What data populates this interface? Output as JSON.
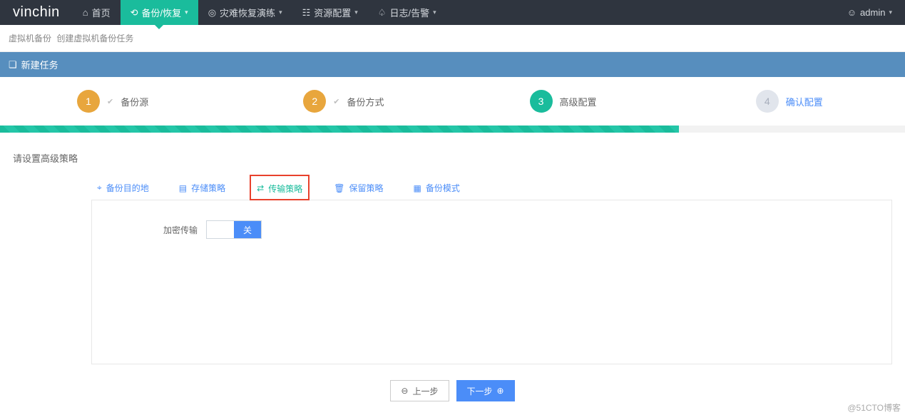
{
  "brand": "vinchin",
  "nav": {
    "home": "首页",
    "backup": "备份/恢复",
    "dr_drill": "灾难恢复演练",
    "resource": "资源配置",
    "logs": "日志/告警"
  },
  "user": {
    "name": "admin"
  },
  "breadcrumb": {
    "a": "虚拟机备份",
    "b": "创建虚拟机备份任务"
  },
  "panel_title": "新建任务",
  "steps": {
    "s1": {
      "num": "1",
      "label": "备份源"
    },
    "s2": {
      "num": "2",
      "label": "备份方式"
    },
    "s3": {
      "num": "3",
      "label": "高级配置"
    },
    "s4": {
      "num": "4",
      "label": "确认配置"
    }
  },
  "section_label": "请设置高级策略",
  "tabs": {
    "dest": "备份目的地",
    "storage": "存储策略",
    "transfer": "传输策略",
    "retain": "保留策略",
    "mode": "备份模式"
  },
  "field": {
    "encrypt_label": "加密传输",
    "switch_off": "关"
  },
  "buttons": {
    "prev": "上一步",
    "next": "下一步"
  },
  "watermark": "@51CTO博客"
}
